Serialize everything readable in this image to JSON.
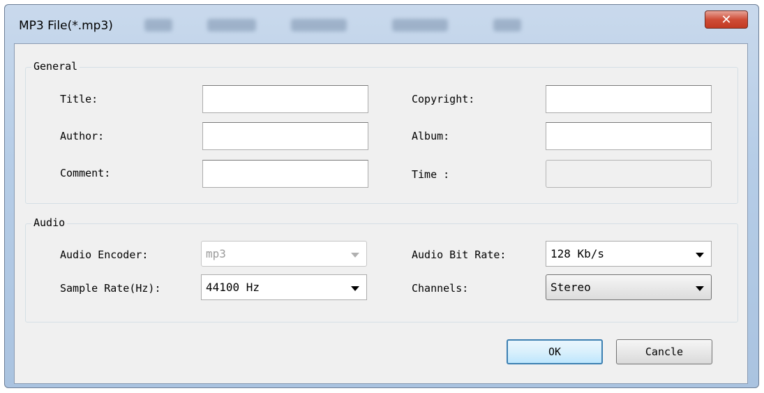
{
  "window": {
    "title": "MP3 File(*.mp3)",
    "close_glyph": "✕"
  },
  "general": {
    "group_label": "General",
    "title_label": "Title:",
    "title_value": "",
    "author_label": "Author:",
    "author_value": "",
    "comment_label": "Comment:",
    "comment_value": "",
    "copyright_label": "Copyright:",
    "copyright_value": "",
    "album_label": "Album:",
    "album_value": "",
    "time_label": "Time :",
    "time_value": ""
  },
  "audio": {
    "group_label": "Audio",
    "encoder_label": "Audio Encoder:",
    "encoder_value": "mp3",
    "sample_rate_label": "Sample Rate(Hz):",
    "sample_rate_value": "44100 Hz",
    "bit_rate_label": "Audio Bit Rate:",
    "bit_rate_value": "128 Kb/s",
    "channels_label": "Channels:",
    "channels_value": "Stereo"
  },
  "buttons": {
    "ok_label": "OK",
    "cancel_label": "Cancle"
  },
  "colors": {
    "close_button": "#c23a22",
    "default_button_border": "#3c7fb1"
  },
  "icons": {
    "close": "close-icon",
    "dropdown": "chevron-down-icon"
  }
}
